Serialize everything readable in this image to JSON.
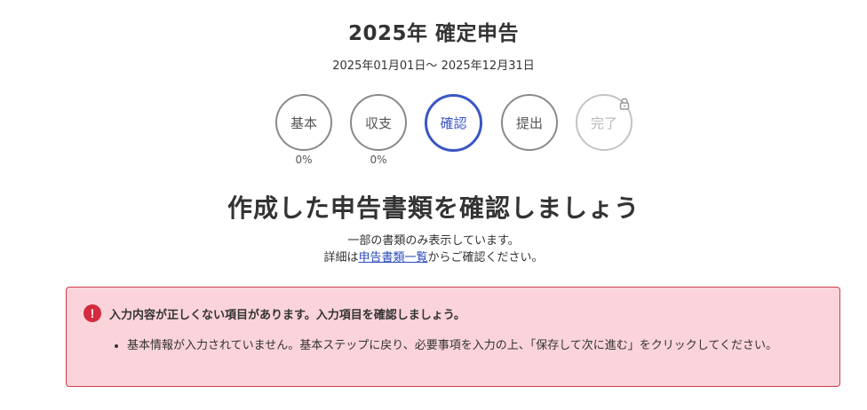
{
  "header": {
    "title": "2025年 確定申告",
    "period": "2025年01月01日〜 2025年12月31日"
  },
  "steps": [
    {
      "label": "基本",
      "percent": "0%",
      "state": "default"
    },
    {
      "label": "収支",
      "percent": "0%",
      "state": "default"
    },
    {
      "label": "確認",
      "percent": "",
      "state": "active"
    },
    {
      "label": "提出",
      "percent": "",
      "state": "default"
    },
    {
      "label": "完了",
      "percent": "",
      "state": "locked",
      "icon": "lock-icon"
    }
  ],
  "main": {
    "heading": "作成した申告書類を確認しましょう",
    "note_line1": "一部の書類のみ表示しています。",
    "note_line2_prefix": "詳細は",
    "note_link": "申告書類一覧",
    "note_line2_suffix": "からご確認ください。"
  },
  "alert": {
    "icon": "error-icon",
    "icon_glyph": "!",
    "title": "入力内容が正しくない項目があります。入力項目を確認しましょう。",
    "items": [
      "基本情報が入力されていません。基本ステップに戻り、必要事項を入力の上、「保存して次に進む」をクリックしてください。"
    ]
  },
  "colors": {
    "accent": "#3a56c4",
    "alert_bg": "#fad4da",
    "alert_border": "#cf3d4f",
    "alert_icon": "#d52b3e",
    "link": "#2a4bbf"
  }
}
